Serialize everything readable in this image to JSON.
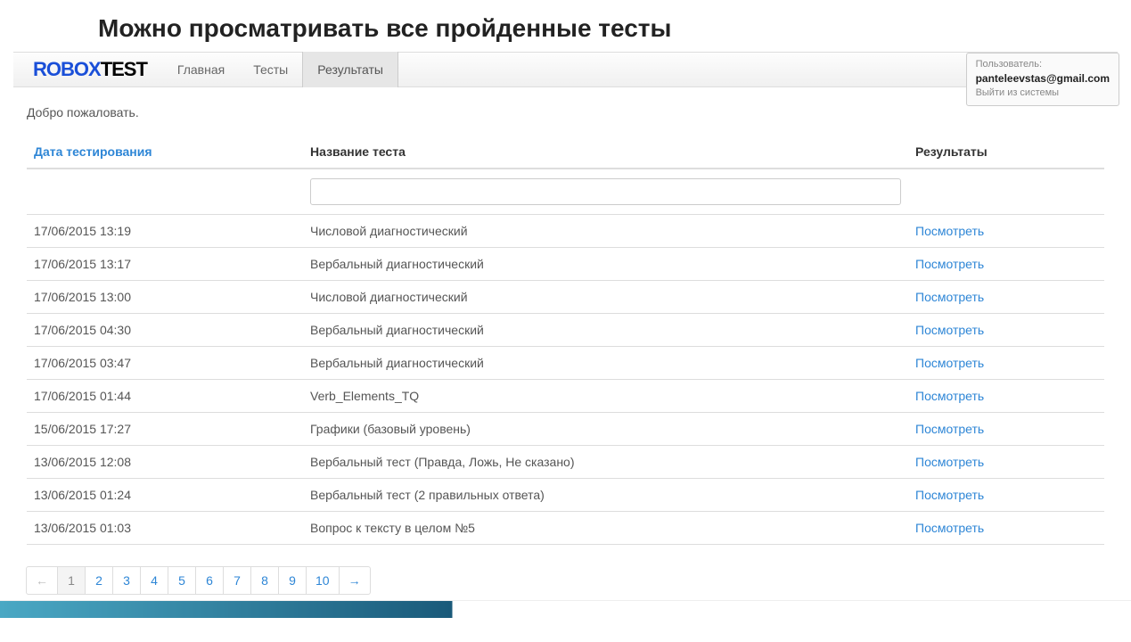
{
  "slideTitle": "Можно просматривать все пройденные тесты",
  "logo": {
    "part1": "ROBOX",
    "part2": "TEST"
  },
  "nav": {
    "items": [
      {
        "label": "Главная",
        "active": false
      },
      {
        "label": "Тесты",
        "active": false
      },
      {
        "label": "Результаты",
        "active": true
      }
    ]
  },
  "userBox": {
    "userLabel": "Пользователь:",
    "email": "panteleevstas@gmail.com",
    "logout": "Выйти из системы"
  },
  "welcome": "Добро пожаловать.",
  "table": {
    "headers": {
      "date": "Дата тестирования",
      "name": "Название теста",
      "results": "Результаты"
    },
    "viewLabel": "Посмотреть",
    "filterValue": "",
    "rows": [
      {
        "date": "17/06/2015 13:19",
        "name": "Числовой диагностический"
      },
      {
        "date": "17/06/2015 13:17",
        "name": "Вербальный диагностический"
      },
      {
        "date": "17/06/2015 13:00",
        "name": "Числовой диагностический"
      },
      {
        "date": "17/06/2015 04:30",
        "name": "Вербальный диагностический"
      },
      {
        "date": "17/06/2015 03:47",
        "name": "Вербальный диагностический"
      },
      {
        "date": "17/06/2015 01:44",
        "name": "Verb_Elements_TQ"
      },
      {
        "date": "15/06/2015 17:27",
        "name": "Графики (базовый уровень)"
      },
      {
        "date": "13/06/2015 12:08",
        "name": "Вербальный тест (Правда, Ложь, Не сказано)"
      },
      {
        "date": "13/06/2015 01:24",
        "name": "Вербальный тест (2 правильных ответа)"
      },
      {
        "date": "13/06/2015 01:03",
        "name": "Вопрос к тексту в целом №5"
      }
    ]
  },
  "pagination": {
    "prev": "←",
    "next": "→",
    "pages": [
      "1",
      "2",
      "3",
      "4",
      "5",
      "6",
      "7",
      "8",
      "9",
      "10"
    ],
    "active": "1"
  }
}
